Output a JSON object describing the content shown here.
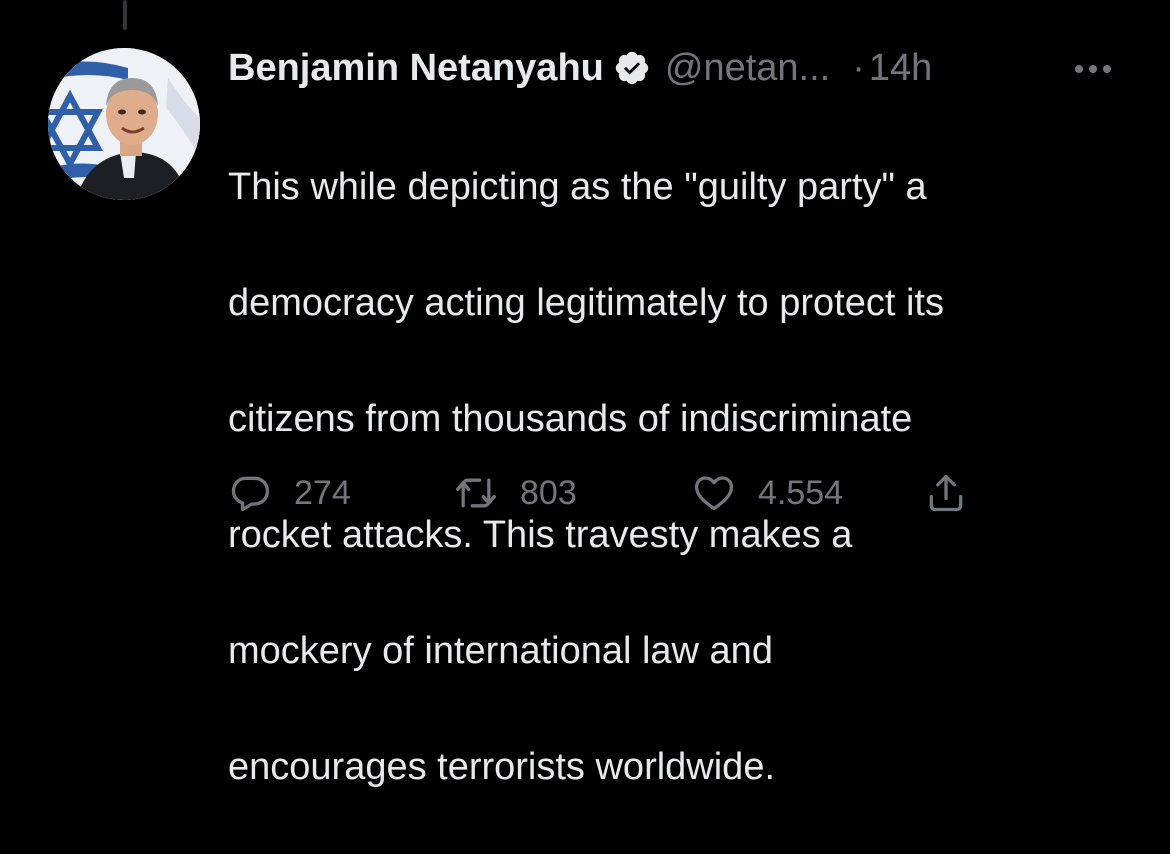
{
  "tweet": {
    "author_name": "Benjamin Netanyahu",
    "handle": "@netan...",
    "separator": "·",
    "timestamp": "14h",
    "text_lines": [
      "This while depicting as the \"guilty party\" a",
      "democracy acting legitimately to protect its",
      "citizens from thousands of indiscriminate",
      "rocket attacks. This travesty makes a",
      "mockery of international law and",
      "encourages terrorists worldwide."
    ],
    "verified": true
  },
  "actions": {
    "reply_count": "274",
    "retweet_count": "803",
    "like_count": "4.554"
  },
  "icons": {
    "verified": "verified-badge-icon",
    "more": "more-options-icon",
    "reply": "reply-icon",
    "retweet": "retweet-icon",
    "like": "heart-icon",
    "share": "share-icon"
  },
  "colors": {
    "background": "#000000",
    "text_primary": "#e7e9ea",
    "text_secondary": "#71767b",
    "thread_line": "#333639"
  }
}
